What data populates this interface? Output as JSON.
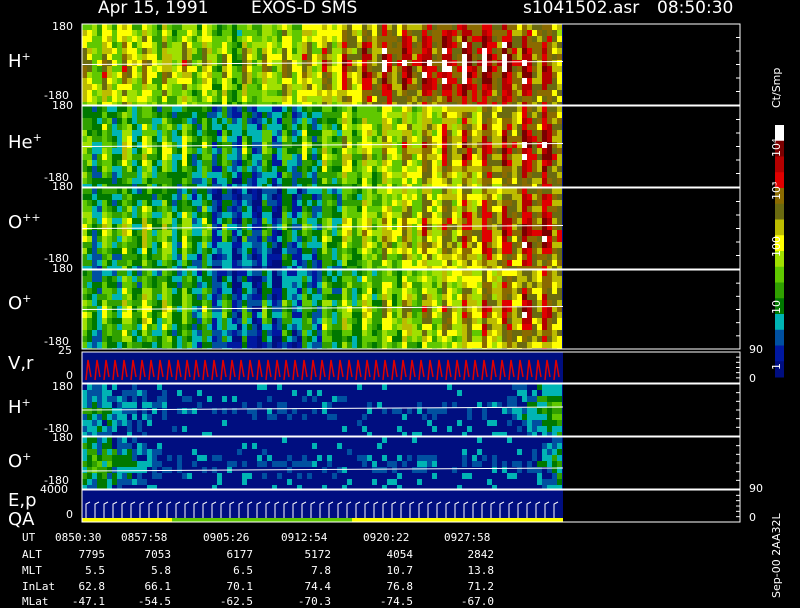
{
  "header": {
    "date": "Apr 15, 1991",
    "instrument": "EXOS-D SMS",
    "file": "s1041502.asr",
    "time": "08:50:30"
  },
  "panels": [
    {
      "label": "H",
      "sup": "+",
      "ymax": "180",
      "ymin": "-180"
    },
    {
      "label": "He",
      "sup": "+",
      "ymax": "180",
      "ymin": "-180"
    },
    {
      "label": "O",
      "sup": "++",
      "ymax": "180",
      "ymin": "-180"
    },
    {
      "label": "O",
      "sup": "+",
      "ymax": "180",
      "ymin": "-180"
    },
    {
      "label": "V,r",
      "sup": "",
      "ymax": "25",
      "ymin": "0",
      "rmax": "90",
      "rmin": "0"
    },
    {
      "label": "H",
      "sup": "+",
      "ymax": "180",
      "ymin": "-180"
    },
    {
      "label": "O",
      "sup": "+",
      "ymax": "180",
      "ymin": "-180"
    },
    {
      "label": "E,p",
      "label2": "QA",
      "sup": "",
      "ymax": "4000",
      "ymin": "0",
      "rmax": "90",
      "rmin": "0"
    }
  ],
  "colorbar": {
    "unit": "Ct/Smp",
    "labels": [
      "10⁴",
      "10³",
      "100",
      "10",
      "1"
    ],
    "colors": [
      "#ffffff",
      "#7a0000",
      "#b40000",
      "#e00000",
      "#8a6a00",
      "#6a6a10",
      "#bcbc00",
      "#ffff00",
      "#a0e000",
      "#60c800",
      "#30a000",
      "#007800",
      "#00b4b4",
      "#0050a0",
      "#0018a0",
      "#000e80"
    ]
  },
  "side_label": "Sep-00  2AA32L",
  "time_table": {
    "row_labels": [
      "UT",
      "ALT",
      "MLT",
      "InLat",
      "MLat"
    ],
    "columns": [
      {
        "UT": "0850:30",
        "ALT": "7795",
        "MLT": "5.5",
        "InLat": "62.8",
        "MLat": "-47.1"
      },
      {
        "UT": "0857:58",
        "ALT": "7053",
        "MLT": "5.8",
        "InLat": "66.1",
        "MLat": "-54.5"
      },
      {
        "UT": "0905:26",
        "ALT": "6177",
        "MLT": "6.5",
        "InLat": "70.1",
        "MLat": "-62.5"
      },
      {
        "UT": "0912:54",
        "ALT": "5172",
        "MLT": "7.8",
        "InLat": "74.4",
        "MLat": "-70.3"
      },
      {
        "UT": "0920:22",
        "ALT": "4054",
        "MLT": "10.7",
        "InLat": "76.8",
        "MLat": "-74.5"
      },
      {
        "UT": "0927:58",
        "ALT": "2842",
        "MLT": "13.8",
        "InLat": "71.2",
        "MLat": "-67.0"
      }
    ]
  },
  "chart_data": {
    "type": "heatmap",
    "title": "Apr 15, 1991   EXOS-D SMS",
    "panels": [
      "H+",
      "He+",
      "O++",
      "O+",
      "V,r",
      "H+",
      "O+",
      "E,p QA"
    ],
    "x_tick_labels_UT": [
      "0850:30",
      "0857:58",
      "0905:26",
      "0912:54",
      "0920:22",
      "0927:58"
    ],
    "color_scale": "log",
    "color_range": [
      1,
      10000
    ],
    "color_unit": "Ct/Smp"
  }
}
